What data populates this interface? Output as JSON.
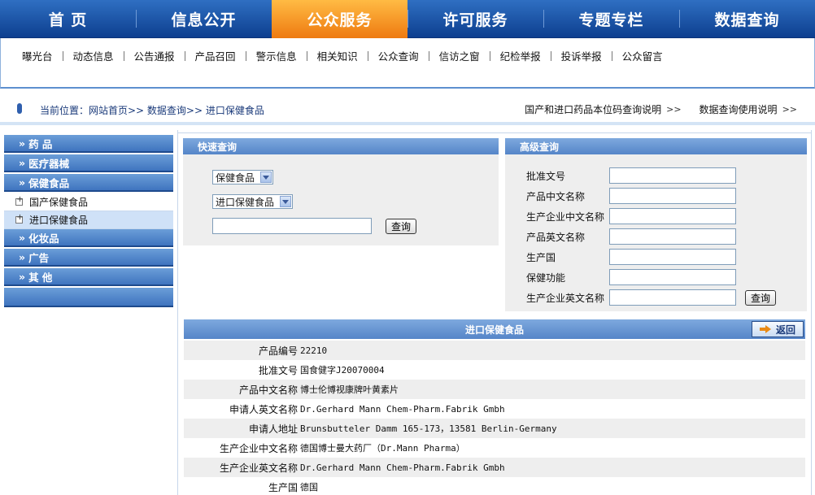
{
  "top_nav": [
    "首 页",
    "信息公开",
    "公众服务",
    "许可服务",
    "专题专栏",
    "数据查询"
  ],
  "top_nav_active": 2,
  "sub_nav": [
    "曝光台",
    "动态信息",
    "公告通报",
    "产品召回",
    "警示信息",
    "相关知识",
    "公众查询",
    "信访之窗",
    "纪检举报",
    "投诉举报",
    "公众留言"
  ],
  "breadcrumb": "当前位置：网站首页>> 数据查询>> 进口保健食品",
  "crumb_links": {
    "link1": "国产和进口药品本位码查询说明",
    "link2": "数据查询使用说明"
  },
  "left_menu": {
    "cat_drug": "药 品",
    "cat_device": "医疗器械",
    "cat_health": "保健食品",
    "sub_domestic": "国产保健食品",
    "sub_import": "进口保健食品",
    "cat_cosmetics": "化妆品",
    "cat_ads": "广告",
    "cat_other": "其 他",
    "arrow": "»"
  },
  "quick": {
    "title": "快速查询",
    "select1": "保健食品",
    "select2": "进口保健食品",
    "input_value": "",
    "button": "查询"
  },
  "advanced": {
    "title": "高级查询",
    "fields": [
      "批准文号",
      "产品中文名称",
      "生产企业中文名称",
      "产品英文名称",
      "生产国",
      "保健功能",
      "生产企业英文名称"
    ],
    "button": "查询"
  },
  "result": {
    "title": "进口保健食品",
    "back": "返回",
    "rows": [
      {
        "k": "产品编号",
        "v": "22210"
      },
      {
        "k": "批准文号",
        "v": "国食健字J20070004"
      },
      {
        "k": "产品中文名称",
        "v": "博士伦博视康牌叶黄素片"
      },
      {
        "k": "申请人英文名称",
        "v": "Dr.Gerhard Mann Chem-Pharm.Fabrik Gmbh"
      },
      {
        "k": "申请人地址",
        "v": "Brunsbutteler Damm 165-173，13581 Berlin-Germany"
      },
      {
        "k": "生产企业中文名称",
        "v": "德国博士曼大药厂（Dr.Mann Pharma）"
      },
      {
        "k": "生产企业英文名称",
        "v": "Dr.Gerhard Mann Chem-Pharm.Fabrik Gmbh"
      },
      {
        "k": "生产国",
        "v": "德国"
      }
    ]
  }
}
